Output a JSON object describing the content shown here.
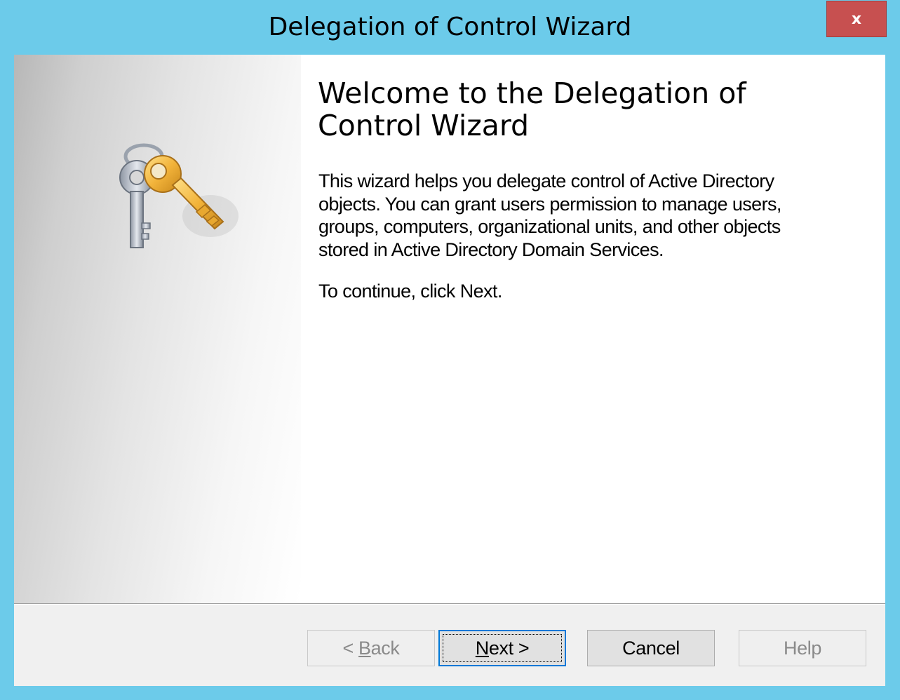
{
  "window": {
    "title": "Delegation of Control Wizard",
    "close_label": "x"
  },
  "side_panel": {
    "icon": "keys-icon"
  },
  "content": {
    "heading": "Welcome to the Delegation of Control Wizard",
    "description": "This wizard helps you delegate control of Active Directory objects. You can grant users permission to manage users, groups, computers, organizational units, and other objects stored in Active Directory Domain Services.",
    "continue_text": "To continue, click Next."
  },
  "buttons": {
    "back": {
      "prefix": "< ",
      "accel": "B",
      "rest": "ack",
      "enabled": false
    },
    "next": {
      "accel": "N",
      "rest": "ext >",
      "enabled": true
    },
    "cancel": {
      "label": "Cancel",
      "enabled": true
    },
    "help": {
      "label": "Help",
      "enabled": false
    }
  },
  "colors": {
    "frame": "#6ccbea",
    "close_button": "#c75050",
    "default_button_border": "#0078d7"
  }
}
